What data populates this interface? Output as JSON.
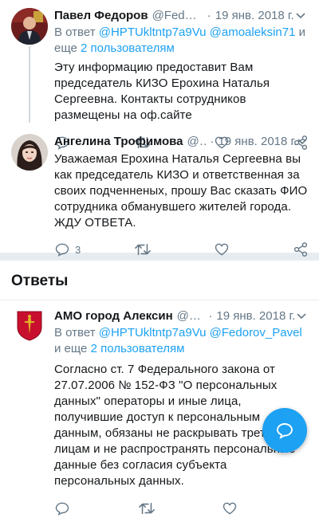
{
  "tweets": [
    {
      "name": "Павел Федоров",
      "handle": "@Fedorov...",
      "dot": "·",
      "time": "19 янв. 2018 г.",
      "reply_prefix": "В ответ",
      "reply_handles": "@HPTUkltntp7a9Vu @amoaleksin71",
      "reply_and": "и еще",
      "reply_more": "2 пользователям",
      "text": "Эту информацию предоставит Вам председатель КИЗО Ерохина Наталья Сергеевна. Контакты сотрудников размещены на оф.сайте"
    },
    {
      "name": "Ангелина Трофимова",
      "handle": "@H...",
      "dot": "·",
      "time": "19 янв. 2018 г.",
      "text": "Уважаемая Ерохина Наталья Сергеевна вы как председатель КИЗО и ответственная за своих подченненых, прошу Вас сказать ФИО сотрудника обманувшего жителей города. ЖДУ ОТВЕТА.",
      "reply_count": "3"
    },
    {
      "name": "АМО город Алексин",
      "handle": "@am...",
      "dot": "·",
      "time": "19 янв. 2018 г.",
      "reply_prefix": "В ответ",
      "reply_handles": "@HPTUkltntp7a9Vu @Fedorov_Pavel",
      "reply_and": "и еще",
      "reply_more": "2 пользователям",
      "text": "Согласно ст. 7 Федерального закона от 27.07.2006 № 152-ФЗ \"О персональных данных\" операторы и иные лица, получившие доступ к персональным данным, обязаны не раскрывать третьим лицам и не распространять персональные данные без согласия субъекта персональных данных."
    }
  ],
  "section_title": "Ответы",
  "icons": {
    "reply": "reply-icon",
    "retweet": "retweet-icon",
    "like": "heart-icon",
    "share": "share-icon",
    "caret": "chevron-down-icon",
    "compose": "compose-reply-icon"
  },
  "colors": {
    "accent": "#1da1f2",
    "secondary_text": "#657786",
    "divider": "#e6ecf0",
    "coat_of_arms_red": "#c8102e",
    "coat_of_arms_gold": "#e0b128"
  }
}
